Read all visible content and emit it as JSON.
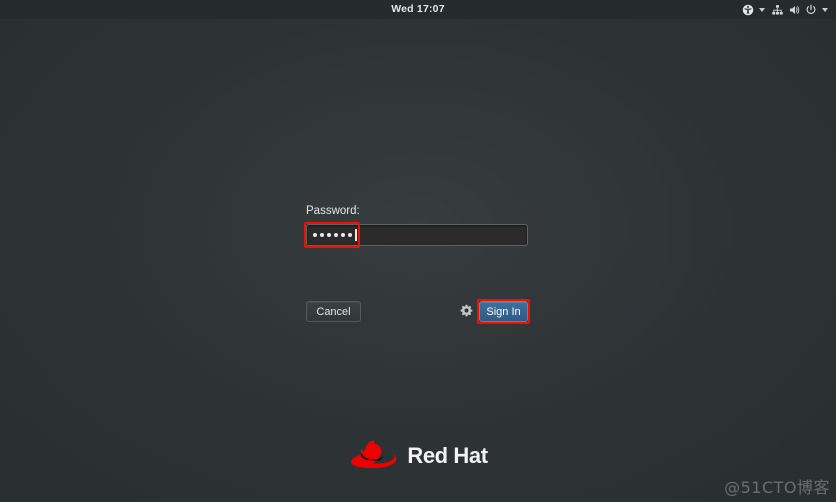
{
  "topbar": {
    "clock": "Wed 17:07",
    "accessibility_icon": "universal-access-icon",
    "accessibility_chevron": "chevron-down-icon",
    "network_icon": "network-wired-icon",
    "volume_icon": "volume-speaker-icon",
    "power_icon": "power-icon",
    "system_chevron": "chevron-down-icon"
  },
  "login": {
    "password_label": "Password:",
    "password_value": "••••••",
    "password_dot_count": 6,
    "cancel_label": "Cancel",
    "signin_label": "Sign In",
    "session_gear_icon": "gear-icon"
  },
  "annotations": {
    "color": "#f01000",
    "password_field_highlight": "red-rectangle-password-field",
    "signin_button_highlight": "red-rectangle-signin-button"
  },
  "branding": {
    "logo_icon": "red-hat-fedora-icon",
    "logo_text": "Red Hat",
    "logo_color": "#ee0000"
  },
  "watermark": {
    "text": "@51CTO博客"
  },
  "theme": {
    "background": "#2e3436",
    "topbar_background": "#252a2c",
    "accent_blue": "#35618d",
    "text_color": "#e6e6e6"
  }
}
